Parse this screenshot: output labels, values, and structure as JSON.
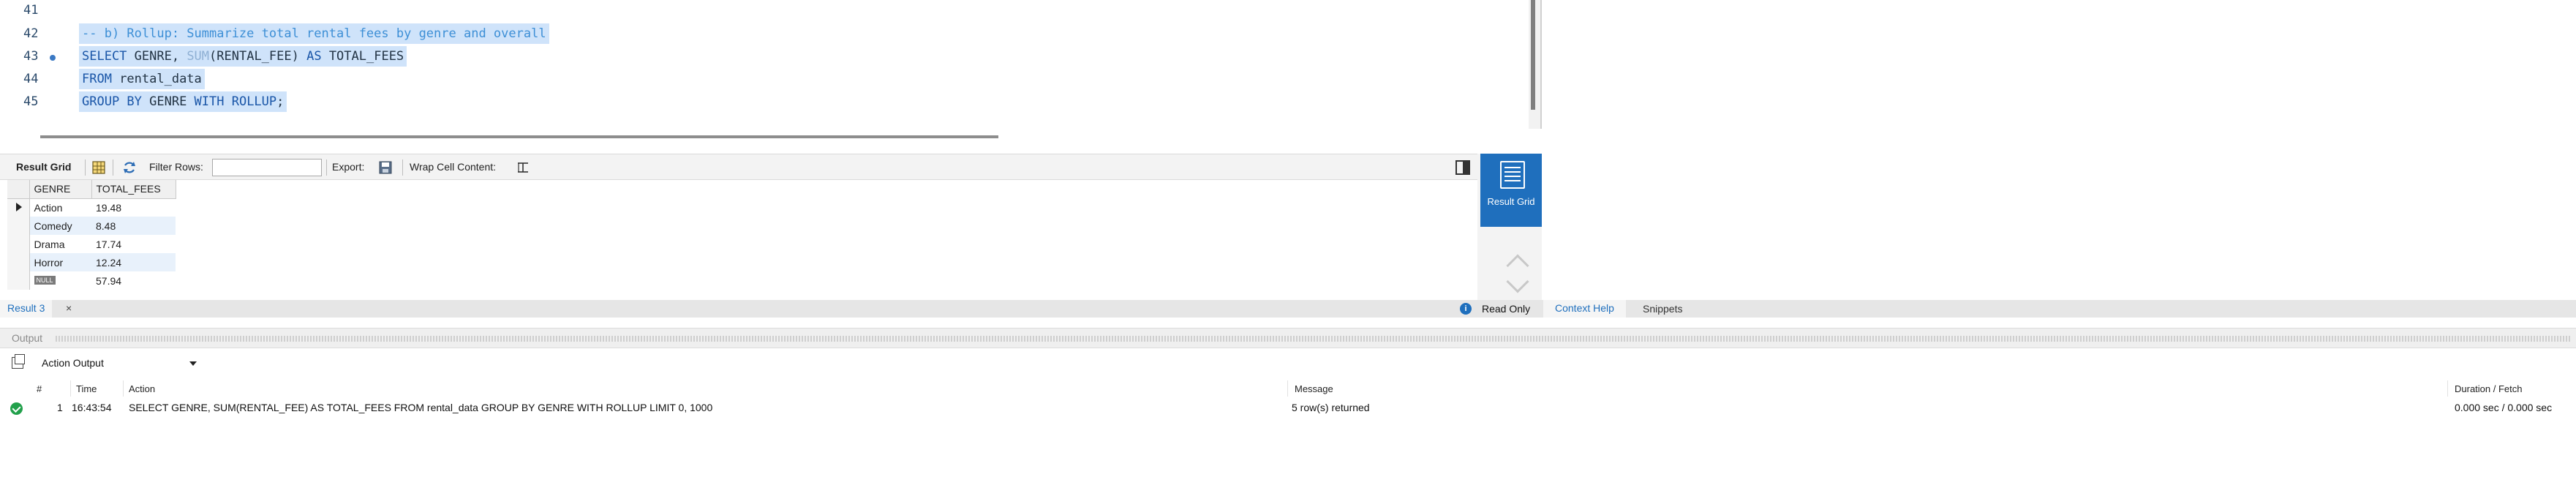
{
  "editor": {
    "line_numbers": [
      "41",
      "42",
      "43",
      "44",
      "45"
    ],
    "lines": [
      {
        "parts": []
      },
      {
        "parts": [
          {
            "t": "-- b) Rollup: Summarize total rental fees by genre and overall",
            "c": "comment"
          }
        ]
      },
      {
        "parts": [
          {
            "t": "SELECT",
            "c": "kw"
          },
          {
            "t": " GENRE, ",
            "c": "plain"
          },
          {
            "t": "SUM",
            "c": "fn"
          },
          {
            "t": "(RENTAL_FEE) ",
            "c": "plain"
          },
          {
            "t": "AS",
            "c": "kw"
          },
          {
            "t": " TOTAL_FEES",
            "c": "plain"
          }
        ]
      },
      {
        "parts": [
          {
            "t": "FROM",
            "c": "kw"
          },
          {
            "t": " rental_data",
            "c": "plain"
          }
        ]
      },
      {
        "parts": [
          {
            "t": "GROUP BY",
            "c": "kw"
          },
          {
            "t": " GENRE ",
            "c": "plain"
          },
          {
            "t": "WITH ROLLUP",
            "c": "kw"
          },
          {
            "t": ";",
            "c": "plain"
          }
        ]
      }
    ]
  },
  "result_toolbar": {
    "result_grid_label": "Result Grid",
    "filter_rows_label": "Filter Rows:",
    "filter_value": "",
    "export_label": "Export:",
    "wrap_label": "Wrap Cell Content:"
  },
  "result_grid": {
    "columns": [
      "GENRE",
      "TOTAL_FEES"
    ],
    "rows": [
      {
        "genre": "Action",
        "fees": "19.48"
      },
      {
        "genre": "Comedy",
        "fees": "8.48"
      },
      {
        "genre": "Drama",
        "fees": "17.74"
      },
      {
        "genre": "Horror",
        "fees": "12.24"
      },
      {
        "genre": "NULL",
        "fees": "57.94"
      }
    ]
  },
  "side_panel": {
    "result_grid_button": "Result Grid"
  },
  "tabs": {
    "result_tab": "Result 3",
    "close_glyph": "×",
    "info_glyph": "i",
    "read_only": "Read Only",
    "context_help": "Context Help",
    "snippets": "Snippets"
  },
  "output": {
    "title": "Output",
    "dropdown_label": "Action Output",
    "columns": {
      "num": "#",
      "time": "Time",
      "action": "Action",
      "message": "Message",
      "duration": "Duration / Fetch"
    },
    "rows": [
      {
        "num": "1",
        "time": "16:43:54",
        "action": "SELECT GENRE, SUM(RENTAL_FEE) AS TOTAL_FEES FROM rental_data GROUP BY GENRE WITH ROLLUP LIMIT 0, 1000",
        "message": "5 row(s) returned",
        "duration": "0.000 sec / 0.000 sec"
      }
    ]
  },
  "colors": {
    "accent": "#1f6fbd",
    "selection": "#cfe3fa",
    "success": "#22a04b"
  },
  "icons": [
    "result-grid-icon",
    "refresh-icon",
    "export-icon",
    "wrap-icon",
    "panel-toggle-icon",
    "info-icon",
    "copy-icon",
    "success-icon"
  ]
}
